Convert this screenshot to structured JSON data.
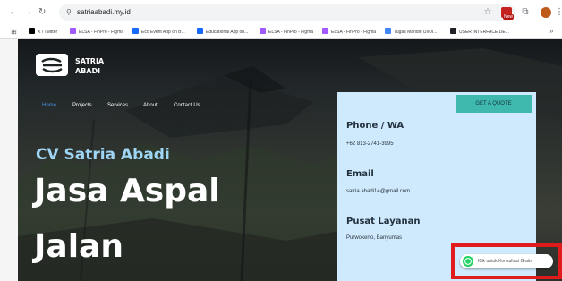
{
  "browser": {
    "url": "satriaabadi.my.id",
    "ext_badge": "New",
    "bookmarks": [
      {
        "label": "X / Twitter",
        "color": "#000000"
      },
      {
        "label": "ELSA - FinPro - Figma",
        "color": "#a259ff"
      },
      {
        "label": "Eco Event App on B...",
        "color": "#1769ff"
      },
      {
        "label": "Educational App on...",
        "color": "#1769ff"
      },
      {
        "label": "ELSA - FinPro - Figma",
        "color": "#a259ff"
      },
      {
        "label": "ELSA - FinPro - Figma",
        "color": "#a259ff"
      },
      {
        "label": "Tugas Mandiri UI/UI...",
        "color": "#4285f4"
      },
      {
        "label": "USER INTERFACE DE...",
        "color": "#202124"
      }
    ],
    "more": "»"
  },
  "site": {
    "logo_line1": "SATRIA",
    "logo_line2": "ABADI",
    "nav": [
      {
        "label": "Home",
        "active": true
      },
      {
        "label": "Projects",
        "active": false
      },
      {
        "label": "Services",
        "active": false
      },
      {
        "label": "About",
        "active": false
      },
      {
        "label": "Contact Us",
        "active": false
      }
    ],
    "company": "CV Satria Abadi",
    "headline_line1": "Jasa Aspal",
    "headline_line2": "Jalan",
    "cta": "GET A QUOTE",
    "contact": {
      "phone_heading": "Phone / WA",
      "phone": "+62 813-2741-3995",
      "email_heading": "Email",
      "email": "satria.abadi14@gmail.com",
      "location_heading": "Pusat Layanan",
      "location": "Purwokerto, Banyumas"
    },
    "whatsapp_label": "Klik untuk Konsultasi Gratis"
  },
  "colors": {
    "accent_blue": "#4a90e2",
    "company_text": "#9fd5f5",
    "card_bg": "#cfeafc",
    "cta_bg": "#3fb8ad",
    "highlight": "#e01b1b",
    "whatsapp": "#25d366"
  },
  "icons": [
    "back-icon",
    "forward-icon",
    "reload-icon",
    "site-info-icon",
    "star-icon",
    "extension-icon",
    "extensions-puzzle-icon",
    "profile-icon",
    "menu-kebab-icon",
    "apps-grid-icon",
    "whatsapp-icon"
  ]
}
